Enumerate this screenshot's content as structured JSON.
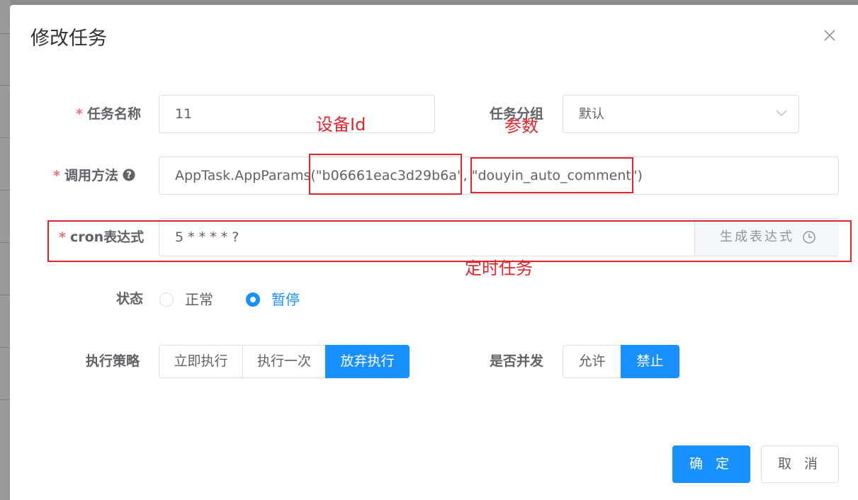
{
  "dialog": {
    "title": "修改任务"
  },
  "form": {
    "task_name": {
      "label": "任务名称",
      "value": "11"
    },
    "task_group": {
      "label": "任务分组",
      "value": "默认"
    },
    "invoke_target": {
      "label": "调用方法",
      "value": "AppTask.AppParams(\"b06661eac3d29b6a\", \"douyin_auto_comment\")"
    },
    "cron": {
      "label": "cron表达式",
      "value": "5 * * * * ?",
      "append_label": "生成表达式"
    },
    "status": {
      "label": "状态",
      "options": [
        "正常",
        "暂停"
      ],
      "selected": "暂停"
    },
    "misfire_policy": {
      "label": "执行策略",
      "options": [
        "立即执行",
        "执行一次",
        "放弃执行"
      ],
      "selected": "放弃执行"
    },
    "concurrent": {
      "label": "是否并发",
      "options": [
        "允许",
        "禁止"
      ],
      "selected": "禁止"
    }
  },
  "footer": {
    "confirm": "确 定",
    "cancel": "取 消"
  },
  "annotations": {
    "device_id": "设备Id",
    "params": "参数",
    "scheduled_task": "定时任务",
    "color": "#e0262d"
  },
  "colors": {
    "primary": "#1890ff",
    "required": "#f56c6c"
  },
  "icons": [
    "close-icon",
    "question-circle-icon",
    "chevron-down-icon",
    "clock-icon"
  ]
}
